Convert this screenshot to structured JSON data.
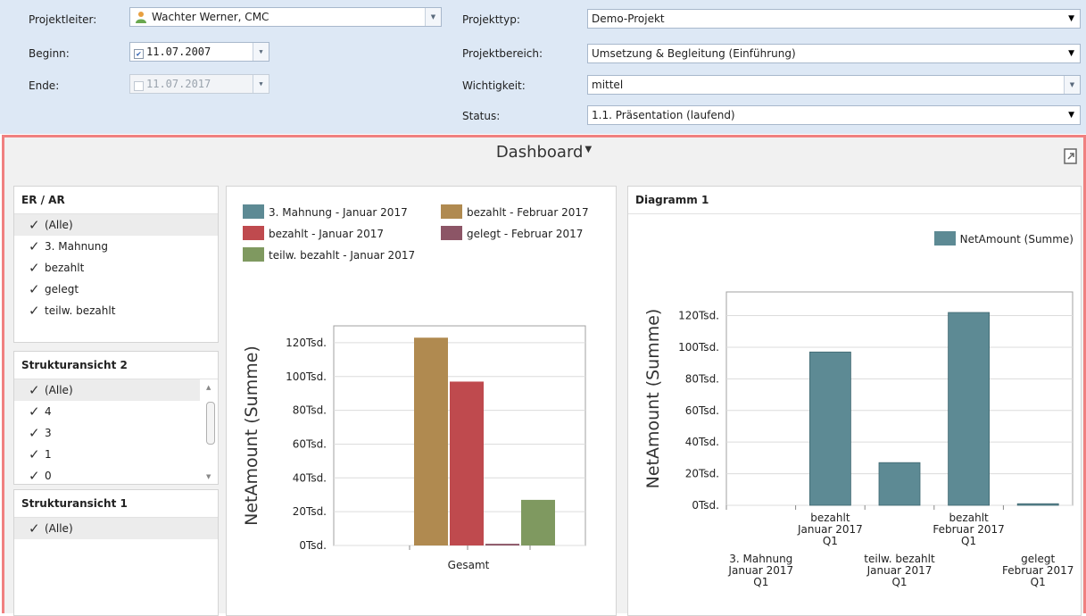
{
  "header": {
    "projektleiter": {
      "label": "Projektleiter:",
      "value": "Wachter Werner, CMC"
    },
    "beginn": {
      "label": "Beginn:",
      "value": "11.07.2007",
      "checked": true
    },
    "ende": {
      "label": "Ende:",
      "value": "11.07.2017",
      "checked": false
    },
    "projekttyp": {
      "label": "Projekttyp:",
      "value": "Demo-Projekt"
    },
    "projektbereich": {
      "label": "Projektbereich:",
      "value": "Umsetzung & Begleitung (Einführung)"
    },
    "wichtigkeit": {
      "label": "Wichtigkeit:",
      "value": "mittel"
    },
    "status": {
      "label": "Status:",
      "value": "1.1. Präsentation (laufend)"
    }
  },
  "dashboard": {
    "title": "Dashboard"
  },
  "filters": [
    {
      "title": "ER / AR",
      "items": [
        "(Alle)",
        "3. Mahnung",
        "bezahlt",
        "gelegt",
        "teilw. bezahlt"
      ]
    },
    {
      "title": "Strukturansicht 2",
      "items": [
        "(Alle)",
        "4",
        "3",
        "1",
        "0"
      ]
    },
    {
      "title": "Strukturansicht 1",
      "items": [
        "(Alle)"
      ]
    }
  ],
  "colors": {
    "teal": "#5d8a94",
    "brown": "#b08a50",
    "red": "#bf4a4e",
    "mauve": "#8c5566",
    "green": "#7f9960"
  },
  "chart_data": [
    {
      "type": "bar",
      "categories": [
        "Gesamt"
      ],
      "ylabel": "NetAmount (Summe)",
      "ylim": [
        0,
        130000
      ],
      "yticks": [
        "0Tsd.",
        "20Tsd.",
        "40Tsd.",
        "60Tsd.",
        "80Tsd.",
        "100Tsd.",
        "120Tsd."
      ],
      "grid": true,
      "legend": "top",
      "series": [
        {
          "name": "3. Mahnung - Januar 2017",
          "color": "#5d8a94",
          "values": [
            0
          ]
        },
        {
          "name": "bezahlt - Februar 2017",
          "color": "#b08a50",
          "values": [
            123000
          ]
        },
        {
          "name": "bezahlt - Januar 2017",
          "color": "#bf4a4e",
          "values": [
            97000
          ]
        },
        {
          "name": "gelegt - Februar 2017",
          "color": "#8c5566",
          "values": [
            1000
          ]
        },
        {
          "name": "teilw. bezahlt - Januar 2017",
          "color": "#7f9960",
          "values": [
            27000
          ]
        }
      ]
    },
    {
      "type": "bar",
      "title": "Diagramm 1",
      "ylabel": "NetAmount (Summe)",
      "ylim": [
        0,
        135000
      ],
      "yticks": [
        "0Tsd.",
        "20Tsd.",
        "40Tsd.",
        "60Tsd.",
        "80Tsd.",
        "100Tsd.",
        "120Tsd."
      ],
      "grid": true,
      "legend": "top-right",
      "series": [
        {
          "name": "NetAmount (Summe)",
          "color": "#5d8a94"
        }
      ],
      "categories": [
        {
          "lines": [
            "3. Mahnung",
            "Januar 2017",
            "Q1"
          ],
          "value": 0,
          "row": 2
        },
        {
          "lines": [
            "bezahlt",
            "Januar 2017",
            "Q1"
          ],
          "value": 97000,
          "row": 1
        },
        {
          "lines": [
            "teilw. bezahlt",
            "Januar 2017",
            "Q1"
          ],
          "value": 27000,
          "row": 2
        },
        {
          "lines": [
            "bezahlt",
            "Februar 2017",
            "Q1"
          ],
          "value": 122000,
          "row": 1
        },
        {
          "lines": [
            "gelegt",
            "Februar 2017",
            "Q1"
          ],
          "value": 1000,
          "row": 2
        }
      ]
    }
  ]
}
